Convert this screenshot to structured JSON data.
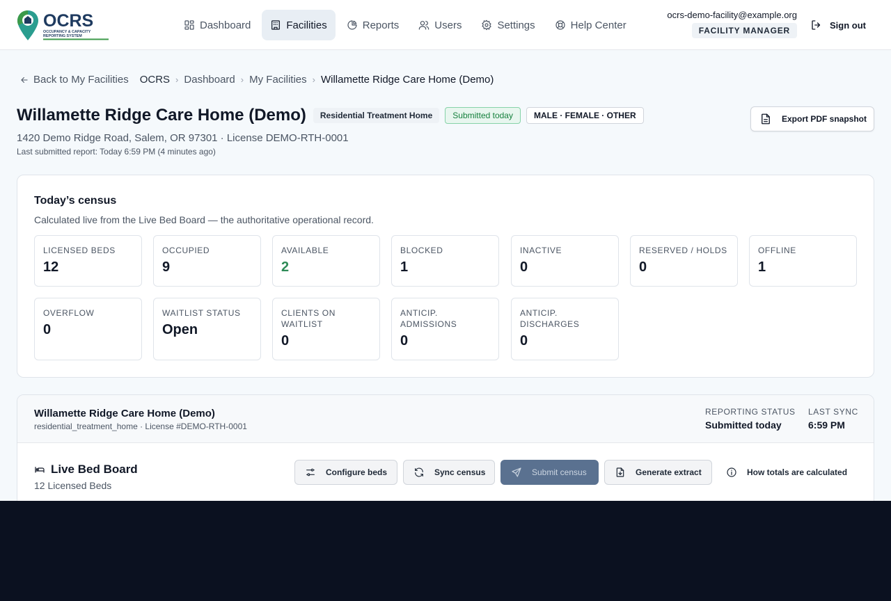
{
  "brand": {
    "name": "OCRS",
    "tagline": "OCCUPANCY & CAPACITY REPORTING SYSTEM",
    "colors": {
      "navy": "#1e3a5f",
      "teal": "#2a9d8f",
      "green": "#3c9a4a"
    }
  },
  "nav": [
    {
      "label": "Dashboard",
      "icon": "dashboard-icon"
    },
    {
      "label": "Facilities",
      "icon": "building-icon",
      "active": true
    },
    {
      "label": "Reports",
      "icon": "report-icon"
    },
    {
      "label": "Users",
      "icon": "users-icon"
    },
    {
      "label": "Settings",
      "icon": "gear-icon"
    },
    {
      "label": "Help Center",
      "icon": "help-icon"
    }
  ],
  "user": {
    "email": "ocrs-demo-facility@example.org",
    "role": "FACILITY MANAGER",
    "sign_out": "Sign out"
  },
  "breadcrumb": {
    "back": "Back to My Facilities",
    "items": [
      "OCRS",
      "Dashboard",
      "My Facilities",
      "Willamette Ridge Care Home (Demo)"
    ]
  },
  "facility": {
    "title": "Willamette Ridge Care Home (Demo)",
    "type_badge": "Residential Treatment Home",
    "status_badge": "Submitted today",
    "gender_badge": "MALE · FEMALE · OTHER",
    "address": "1420 Demo Ridge Road, Salem, OR 97301 · License DEMO-RTH-0001",
    "last_submitted": "Last submitted report: Today 6:59 PM (4 minutes ago)",
    "export_label": "Export PDF snapshot"
  },
  "census": {
    "title": "Today’s census",
    "subtitle": "Calculated live from the Live Bed Board — the authoritative operational record.",
    "stats": [
      {
        "label": "LICENSED BEDS",
        "value": "12"
      },
      {
        "label": "OCCUPIED",
        "value": "9"
      },
      {
        "label": "AVAILABLE",
        "value": "2"
      },
      {
        "label": "BLOCKED",
        "value": "1"
      },
      {
        "label": "INACTIVE",
        "value": "0"
      },
      {
        "label": "RESERVED / HOLDS",
        "value": "0"
      },
      {
        "label": "OFFLINE",
        "value": "1"
      },
      {
        "label": "OVERFLOW",
        "value": "0"
      },
      {
        "label": "WAITLIST STATUS",
        "value": "Open"
      },
      {
        "label": "CLIENTS ON WAITLIST",
        "value": "0"
      },
      {
        "label": "ANTICIP. ADMISSIONS",
        "value": "0"
      },
      {
        "label": "ANTICIP. DISCHARGES",
        "value": "0"
      }
    ]
  },
  "bed_board": {
    "facility_name": "Willamette Ridge Care Home (Demo)",
    "facility_meta": "residential_treatment_home · License #DEMO-RTH-0001",
    "reporting_status_label": "REPORTING STATUS",
    "reporting_status_value": "Submitted today",
    "last_sync_label": "LAST SYNC",
    "last_sync_value": "6:59 PM",
    "title": "Live Bed Board",
    "subtitle": "12 Licensed Beds",
    "buttons": {
      "configure": "Configure beds",
      "sync": "Sync census",
      "submit": "Submit census",
      "extract": "Generate extract",
      "how": "How totals are calculated"
    }
  }
}
